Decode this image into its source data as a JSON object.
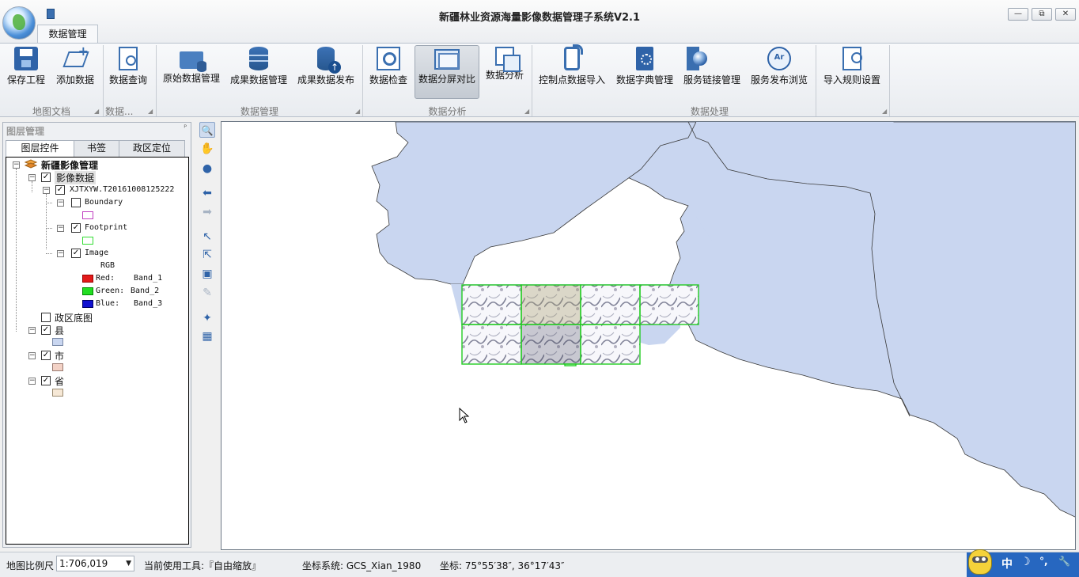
{
  "app": {
    "title": "新疆林业资源海量影像数据管理子系统V2.1",
    "tab": "数据管理",
    "window_controls": {
      "minimize": "—",
      "restore": "⧉",
      "close": "✕"
    }
  },
  "ribbon": {
    "buttons": [
      {
        "label": "保存工程",
        "icon": "save-icon"
      },
      {
        "label": "添加数据",
        "icon": "add-layer-icon"
      },
      {
        "label": "数据查询",
        "icon": "query-icon"
      },
      {
        "label": "原始数据管理",
        "icon": "folder-db-icon"
      },
      {
        "label": "成果数据管理",
        "icon": "database-icon"
      },
      {
        "label": "成果数据发布",
        "icon": "database-upload-icon"
      },
      {
        "label": "数据检查",
        "icon": "inspect-icon"
      },
      {
        "label": "数据分屏对比",
        "icon": "split-screen-icon"
      },
      {
        "label": "数据分析",
        "icon": "analysis-icon"
      },
      {
        "label": "控制点数据导入",
        "icon": "phone-import-icon"
      },
      {
        "label": "数据字典管理",
        "icon": "dictionary-icon"
      },
      {
        "label": "服务链接管理",
        "icon": "globe-link-icon"
      },
      {
        "label": "服务发布浏览",
        "icon": "arcgis-icon"
      },
      {
        "label": "导入规则设置",
        "icon": "rule-settings-icon"
      }
    ],
    "groups": [
      "地图文档",
      "数据...",
      "数据管理",
      "数据分析",
      "数据处理"
    ]
  },
  "layer_panel": {
    "title": "图层管理",
    "pin": "ᴾ",
    "tabs": [
      "图层控件",
      "书签",
      "政区定位"
    ],
    "tree": {
      "root": "新疆影像管理",
      "image_data": "影像数据",
      "dataset": "XJTXYW.T20161008125222",
      "boundary": "Boundary",
      "footprint": "Footprint",
      "image": "Image",
      "rgb": "RGB",
      "red_label": "Red:",
      "red_band": "Band_1",
      "green_label": "Green:",
      "green_band": "Band_2",
      "blue_label": "Blue:",
      "blue_band": "Band_3",
      "admin_base": "政区底图",
      "county": "县",
      "city": "市",
      "province": "省"
    }
  },
  "tools": [
    "zoom-in-tool",
    "pan-tool",
    "full-extent-tool",
    "back-tool",
    "forward-tool",
    "select-tool",
    "edit-vertex-tool",
    "select-box-tool",
    "clear-tool",
    "identify-tool",
    "swipe-tool"
  ],
  "statusbar": {
    "scale_label": "地图比例尺",
    "scale_value": "1:706,019",
    "tool_label": "当前使用工具:『自由缩放』",
    "crs": "坐标系统: GCS_Xian_1980",
    "coords": "坐标: 75°55′38″, 36°17′43″"
  },
  "ime": {
    "mode": "中",
    "moon": "☽",
    "punct": "°,",
    "settings": "🔧"
  },
  "colors": {
    "region_fill": "#c9d6f0",
    "footprint": "#22cc22",
    "accent": "#2f63a8",
    "red_swatch": "#e31a1a",
    "green_swatch": "#22dd22",
    "blue_swatch": "#1010d0",
    "boundary_swatch": "#c040c0",
    "footprint_swatch": "#33dd33",
    "county_swatch": "#c9d6f0",
    "city_swatch": "#f3d2c6",
    "province_swatch": "#f6e8d6"
  }
}
